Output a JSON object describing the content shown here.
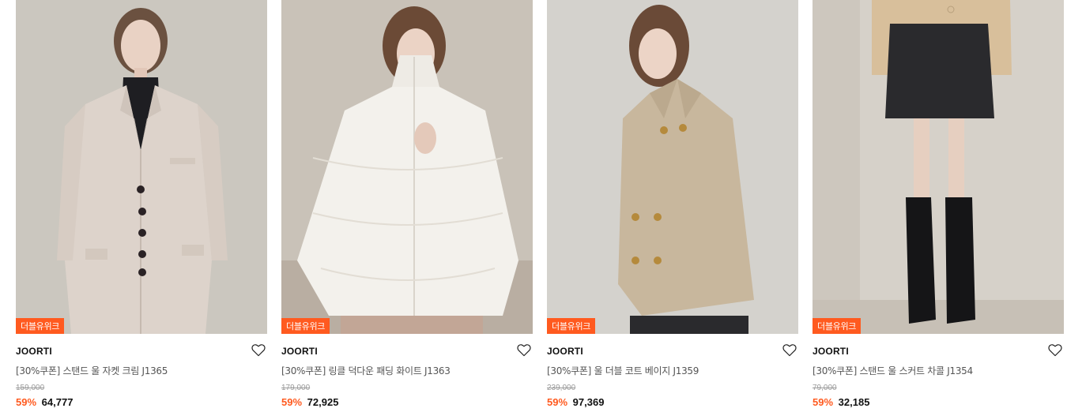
{
  "products": [
    {
      "badge": "더블유위크",
      "brand": "JOORTI",
      "name": "[30%쿠폰] 스탠드 울 자켓 크림 J1365",
      "original_price": "159,000",
      "discount": "59%",
      "sale_price": "64,777",
      "image_icon": "model-in-cream-wool-jacket",
      "colors": {
        "bg": "#cfcac3",
        "garment": "#ddd3cb"
      }
    },
    {
      "badge": "더블유위크",
      "brand": "JOORTI",
      "name": "[30%쿠폰] 링클 덕다운 패딩 화이트 J1363",
      "original_price": "179,000",
      "discount": "59%",
      "sale_price": "72,925",
      "image_icon": "model-in-white-puffer-jacket",
      "colors": {
        "bg": "#c9c2b8",
        "garment": "#f3f1ec"
      }
    },
    {
      "badge": "더블유위크",
      "brand": "JOORTI",
      "name": "[30%쿠폰] 울 더블 코트 베이지 J1359",
      "original_price": "239,000",
      "discount": "59%",
      "sale_price": "97,369",
      "image_icon": "model-in-beige-double-coat",
      "colors": {
        "bg": "#d4d2cd",
        "garment": "#c8b79d"
      }
    },
    {
      "badge": "더블유위크",
      "brand": "JOORTI",
      "name": "[30%쿠폰] 스탠드 울 스커트 차콜 J1354",
      "original_price": "79,000",
      "discount": "59%",
      "sale_price": "32,185",
      "image_icon": "model-in-charcoal-skirt-and-boots",
      "colors": {
        "bg": "#d6d1c9",
        "garment": "#2a2a2d"
      }
    }
  ],
  "wishlist_icon": "heart-outline-icon",
  "accent_color": "#ff5a1f"
}
